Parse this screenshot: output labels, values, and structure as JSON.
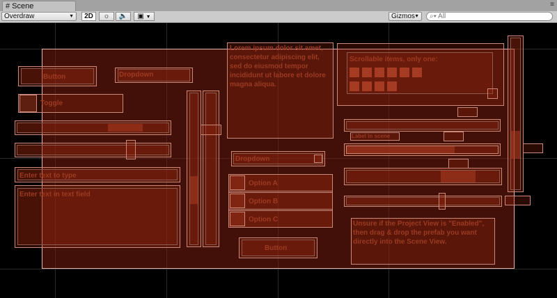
{
  "window": {
    "tab_label": "Scene",
    "tab_icon": "grid-icon"
  },
  "toolbar": {
    "draw_mode": "Overdraw",
    "mode_2d": "2D",
    "gizmos_label": "Gizmos",
    "search_placeholder": "All"
  },
  "scene": {
    "button_top": "Button",
    "dropdown_top": "Dropdown",
    "toggle_label": "Toggle",
    "text_block": "Lorem ipsum dolor sit amet, consectetur adipiscing elit, sed do eiusmod tempor incididunt ut labore et dolore magna aliqua.",
    "grid_panel_title": "Scrollable items, only one:",
    "dropdown_mid": "Dropdown",
    "input_field": "Enter text to type",
    "input_field_multi": "Enter text in text field",
    "options": [
      "Option A",
      "Option B",
      "Option C"
    ],
    "button_bottom": "Button",
    "note_text": "Unsure if the Project View is \"Enabled\", then drag & drop the prefab you want directly into the Scene View.",
    "small_label": "Label in scene"
  }
}
